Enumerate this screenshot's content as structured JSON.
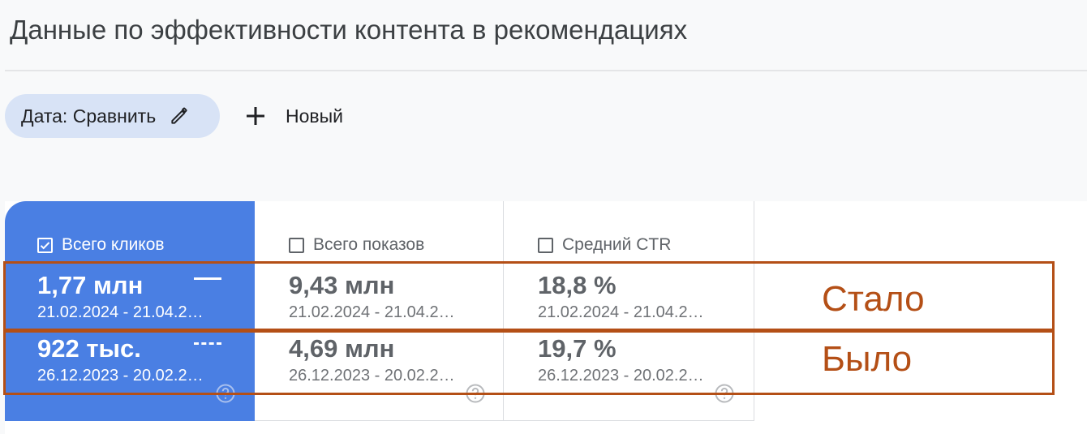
{
  "page": {
    "title": "Данные по эффективности контента в рекомендациях"
  },
  "toolbar": {
    "date_chip_label": "Дата: Сравнить",
    "new_label": "Новый"
  },
  "metrics": [
    {
      "label": "Всего кликов",
      "checked": true,
      "current_value": "1,77 млн",
      "current_range": "21.02.2024 - 21.04.2…",
      "previous_value": "922 тыс.",
      "previous_range": "26.12.2023 - 20.02.2…"
    },
    {
      "label": "Всего показов",
      "checked": false,
      "current_value": "9,43 млн",
      "current_range": "21.02.2024 - 21.04.2…",
      "previous_value": "4,69 млн",
      "previous_range": "26.12.2023 - 20.02.2…"
    },
    {
      "label": "Средний CTR",
      "checked": false,
      "current_value": "18,8 %",
      "current_range": "21.02.2024 - 21.04.2…",
      "previous_value": "19,7 %",
      "previous_range": "26.12.2023 - 20.02.2…"
    }
  ],
  "annotations": {
    "current_label": "Стало",
    "previous_label": "Было",
    "color": "#b44f16"
  },
  "colors": {
    "accent": "#4a7fe3",
    "chip_bg": "#d8e3f6"
  },
  "icons": [
    "pencil-icon",
    "plus-icon",
    "checkbox-checked-icon",
    "checkbox-empty-icon",
    "help-icon"
  ]
}
